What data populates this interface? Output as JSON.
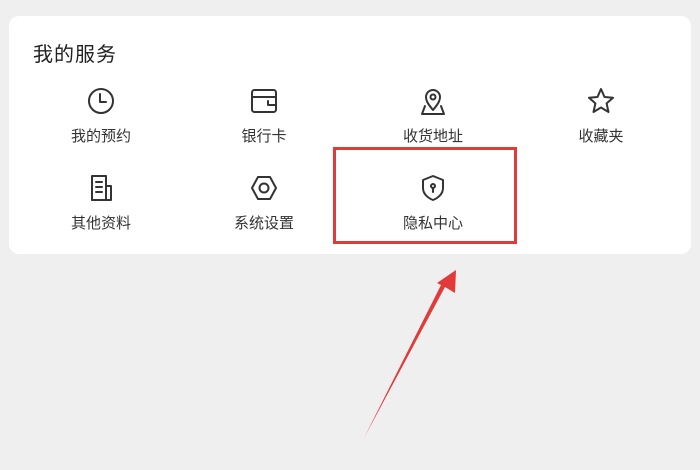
{
  "services": {
    "title": "我的服务",
    "items": [
      {
        "label": "我的预约",
        "icon": "clock-icon"
      },
      {
        "label": "银行卡",
        "icon": "wallet-icon"
      },
      {
        "label": "收货地址",
        "icon": "location-pin-icon"
      },
      {
        "label": "收藏夹",
        "icon": "star-icon"
      },
      {
        "label": "其他资料",
        "icon": "document-icon"
      },
      {
        "label": "系统设置",
        "icon": "settings-hexagon-icon"
      },
      {
        "label": "隐私中心",
        "icon": "privacy-shield-icon"
      }
    ]
  },
  "annotation": {
    "highlight_color": "#e03a3a",
    "highlighted_item": "隐私中心"
  }
}
